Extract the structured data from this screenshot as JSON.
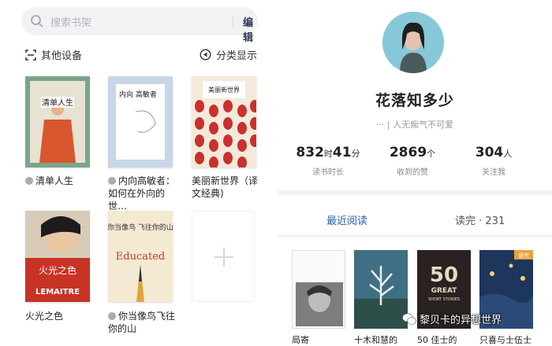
{
  "bookshelf": {
    "search_placeholder": "搜索书架",
    "edit_label": "编辑",
    "other_devices": "其他设备",
    "sort_display": "分类显示",
    "books": [
      {
        "title": "清单人生",
        "cover_text": "清单人生",
        "synced": true
      },
      {
        "title": "内向高敏者：如何在外向的世…",
        "cover_text": "内向 高敏者",
        "synced": true
      },
      {
        "title": "美丽新世界（译文经典)",
        "cover_text": "美丽新世界",
        "synced": false
      },
      {
        "title": "火光之色",
        "cover_text": "火光之色",
        "cover_sub": "LEMAITRE",
        "synced": false
      },
      {
        "title": "你当像鸟飞往你的山",
        "cover_text": "你当像鸟 飞往你的山",
        "cover_sub": "Educated",
        "synced": true
      }
    ],
    "add_icon": "plus-icon"
  },
  "profile": {
    "name": "花落知多少",
    "signature": "··· | 人无痴气不可爱",
    "stats": [
      {
        "value_a": "832",
        "unit_a": "时",
        "value_b": "41",
        "unit_b": "分",
        "label": "读书时长"
      },
      {
        "value_a": "2869",
        "unit_a": "个",
        "label": "收到的赞"
      },
      {
        "value_a": "304",
        "unit_a": "人",
        "label": "关注我"
      }
    ],
    "tabs": {
      "recent": "最近阅读",
      "finished": "读完 · 231"
    },
    "recent_books": [
      {
        "title": "局寄"
      },
      {
        "title": "十木和慧的"
      },
      {
        "title": "50 佳士的",
        "cover_text": "50 GREAT SHORT STORIES"
      },
      {
        "title": "只喜与士伍士",
        "badge": "读完"
      }
    ]
  },
  "watermark": "黎贝卡的异想世界",
  "colors": {
    "accent": "#2a63ad",
    "edit": "#2f3b55"
  }
}
